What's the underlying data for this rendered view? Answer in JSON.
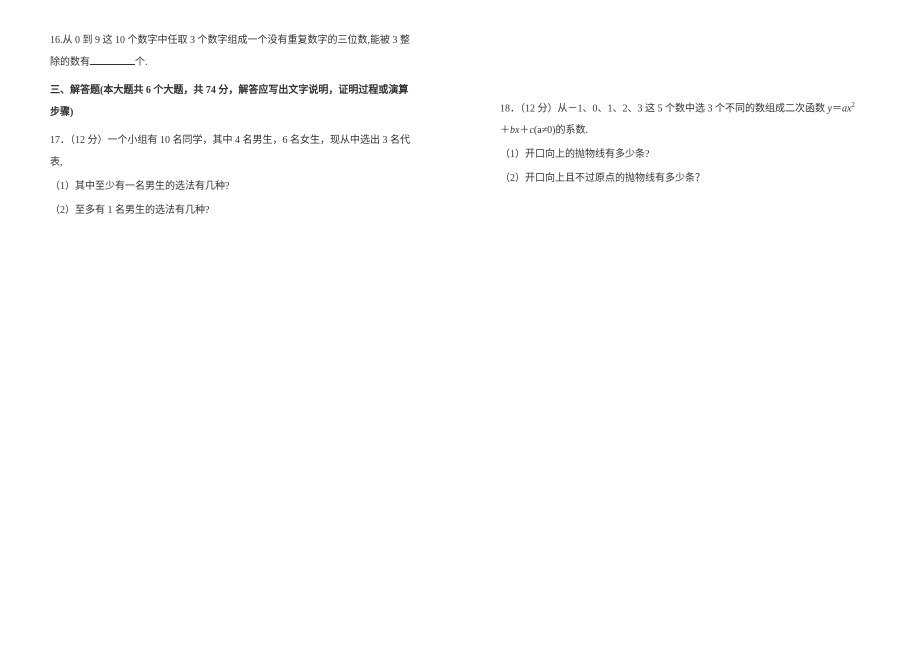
{
  "left": {
    "q16": {
      "prefix": "16.从 0 到 9 这 10 个数字中任取 3 个数字组成一个没有重复数字的三位数,能被 3 整除的数有",
      "suffix": "个."
    },
    "section3": "三、解答题(本大题共 6 个大题，共 74 分，解答应写出文字说明，证明过程或演算步骤)",
    "q17": {
      "main": "17．（12 分）一个小组有 10 名同学，其中 4 名男生，6 名女生，现从中选出 3 名代表,",
      "sub1": "（1）其中至少有一名男生的选法有几种?",
      "sub2": "（2）至多有 1 名男生的选法有几种?"
    }
  },
  "right": {
    "q18": {
      "main_prefix": "18．（12 分）从－1、0、1、2、3 这 5 个数中选 3 个不同的数组成二次函数 ",
      "formula_y": "y",
      "formula_eq": "＝",
      "formula_a": "a",
      "formula_x": "x",
      "formula_plus": "＋",
      "formula_b": "b",
      "formula_c": "c",
      "formula_cond": "(a≠0)",
      "main_suffix": "的系数.",
      "sub1": "（1）开口向上的抛物线有多少条?",
      "sub2": "（2）开口向上且不过原点的抛物线有多少条？"
    }
  }
}
